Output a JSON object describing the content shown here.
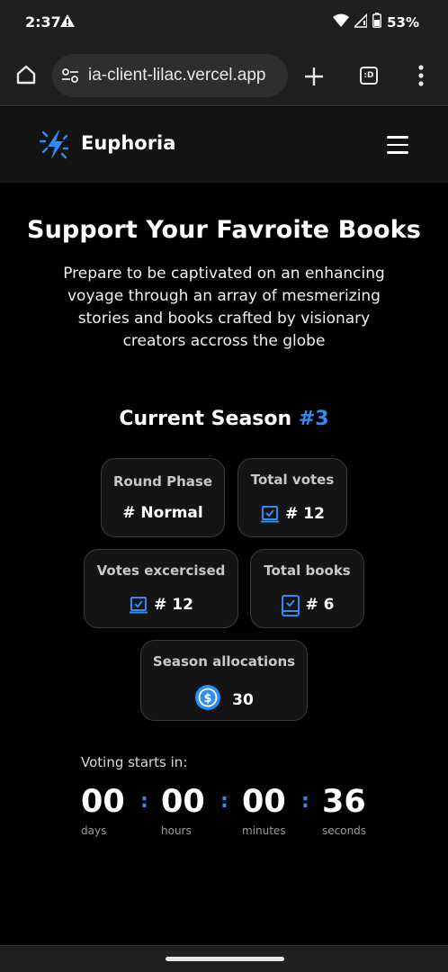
{
  "status_bar": {
    "time": "2:37",
    "battery_percent": "53%",
    "icons": [
      "warning-icon",
      "wifi-icon",
      "signal-icon",
      "battery-icon"
    ]
  },
  "browser": {
    "url": "ia-client-lilac.vercel.app",
    "tabs_label": ":D",
    "icons": [
      "home-icon",
      "site-settings-icon",
      "plus-icon",
      "more-vert-icon"
    ]
  },
  "app": {
    "brand": "Euphoria",
    "accent_color": "#2f8cf5"
  },
  "hero": {
    "title": "Support Your Favroite Books",
    "description": "Prepare to be captivated on an enhancing voyage through an array of mesmerizing stories and books crafted by visionary creators accross the globe"
  },
  "season": {
    "label": "Current Season",
    "number": "#3"
  },
  "stats": {
    "round_phase": {
      "label": "Round Phase",
      "value": "# Normal"
    },
    "total_votes": {
      "label": "Total votes",
      "value": "# 12",
      "icon": "vote-box-icon"
    },
    "votes_exercised": {
      "label": "Votes excercised",
      "value": "# 12",
      "icon": "vote-box-icon"
    },
    "total_books": {
      "label": "Total books",
      "value": "# 6",
      "icon": "book-icon"
    },
    "season_allocations": {
      "label": "Season allocations",
      "value": "30",
      "icon": "usdc-coin-icon"
    }
  },
  "countdown": {
    "label": "Voting starts in:",
    "days": "00",
    "days_label": "days",
    "hours": "00",
    "hours_label": "hours",
    "minutes": "00",
    "minutes_label": "minutes",
    "seconds": "36",
    "seconds_label": "seconds",
    "separator": ":"
  }
}
